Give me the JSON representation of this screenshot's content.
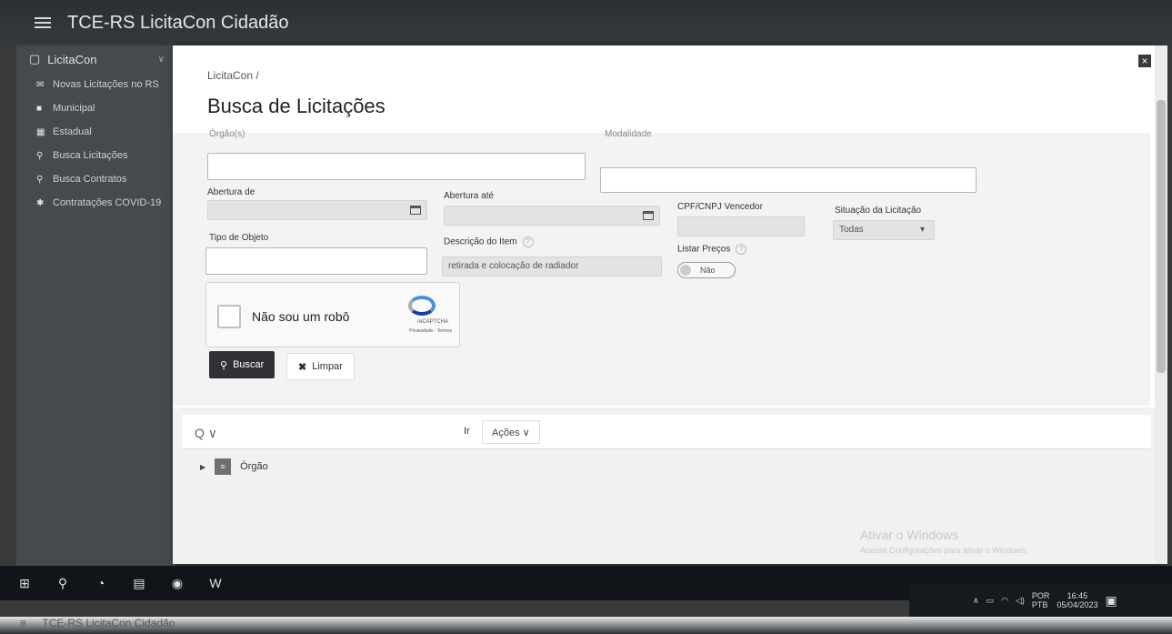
{
  "app": {
    "title": "TCE-RS LicitaCon Cidadão"
  },
  "sidebar": {
    "section": "LicitaCon",
    "items": [
      {
        "label": "Novas Licitações no RS",
        "icon": "megaphone-icon",
        "glyph": "✉"
      },
      {
        "label": "Municipal",
        "icon": "building-icon",
        "glyph": "■"
      },
      {
        "label": "Estadual",
        "icon": "grid-icon",
        "glyph": "▦"
      },
      {
        "label": "Busca Licitações",
        "icon": "search-icon",
        "glyph": "⚲"
      },
      {
        "label": "Busca Contratos",
        "icon": "search-icon",
        "glyph": "⚲"
      },
      {
        "label": "Contratações COVID-19",
        "icon": "virus-icon",
        "glyph": "✱"
      }
    ]
  },
  "page": {
    "breadcrumb": "LicitaCon /",
    "title": "Busca de Licitações",
    "close": "×"
  },
  "form": {
    "orgao_label": "Órgão(s)",
    "modalidade_label": "Modalidade",
    "abertura_de_label": "Abertura de",
    "abertura_ate_label": "Abertura até",
    "cpf_label": "CPF/CNPJ Vencedor",
    "situacao_label": "Situação da Licitação",
    "situacao_value": "Todas",
    "tipo_objeto_label": "Tipo de Objeto",
    "descricao_label": "Descrição do Item",
    "descricao_value": "retirada e colocação de radiador",
    "listar_precos_label": "Listar Preços",
    "listar_precos_value": "Não",
    "help": "?"
  },
  "captcha": {
    "text": "Não sou um robô",
    "brand": "reCAPTCHA",
    "terms": "Privacidade - Termos"
  },
  "buttons": {
    "search": "Buscar",
    "clear": "Limpar"
  },
  "report": {
    "search_icon": "Q",
    "ir": "Ir",
    "acoes": "Ações ∨",
    "row_label": "Órgão"
  },
  "watermark": {
    "line1": "Ativar o Windows",
    "line2": "Acesse Configurações para ativar o Windows."
  },
  "taskbar": {
    "lang1": "POR",
    "lang2": "PTB",
    "time": "16:45",
    "date": "05/04/2023"
  },
  "bottom_app_title": "TCE-RS LicitaCon Cidadão"
}
